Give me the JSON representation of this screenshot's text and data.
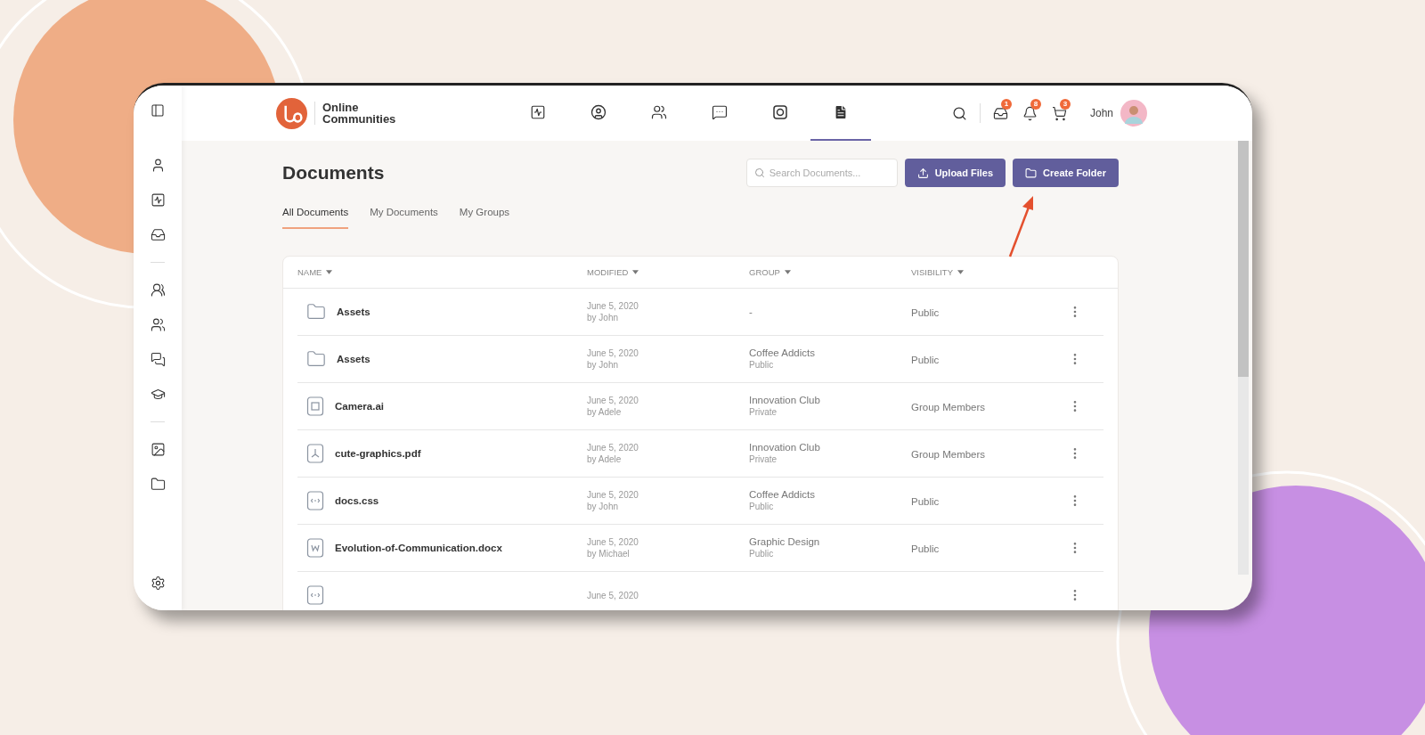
{
  "header": {
    "brand": [
      "Online",
      "Communities"
    ],
    "nav": [
      {
        "selected": false
      },
      {
        "selected": false
      },
      {
        "selected": false
      },
      {
        "selected": false
      },
      {
        "selected": false
      },
      {
        "selected": true
      }
    ],
    "badges": [
      "1",
      "8",
      "3"
    ],
    "user_name": "John"
  },
  "page": {
    "title": "Documents",
    "search": {
      "placeholder": "Search Documents..."
    },
    "buttons": [
      {
        "kind": "upload",
        "label": "Upload Files"
      },
      {
        "kind": "folder",
        "label": "Create Folder"
      }
    ],
    "tabs": [
      {
        "label": "All Documents",
        "selected": true
      },
      {
        "label": "My Documents",
        "selected": false
      },
      {
        "label": "My Groups",
        "selected": false
      }
    ]
  },
  "table": {
    "columns": [
      "NAME",
      "MODIFIED",
      "GROUP",
      "VISIBILITY"
    ],
    "rows": [
      {
        "kind": "folder",
        "name": "Assets",
        "date": "June 5, 2020",
        "by": "by John",
        "group": "-",
        "visibility": "Public"
      },
      {
        "kind": "folder",
        "name": "Assets",
        "date": "June 5, 2020",
        "by": "by John",
        "group": "Coffee Addicts",
        "group_sub": "Public",
        "visibility": "Public"
      },
      {
        "kind": "ai",
        "name": "Camera.ai",
        "date": "June 5, 2020",
        "by": "by Adele",
        "group": "Innovation Club",
        "group_sub": "Private",
        "visibility": "Group Members"
      },
      {
        "kind": "pdf",
        "name": "cute-graphics.pdf",
        "date": "June 5, 2020",
        "by": "by Adele",
        "group": "Innovation Club",
        "group_sub": "Private",
        "visibility": "Group Members"
      },
      {
        "kind": "code",
        "name": "docs.css",
        "date": "June 5, 2020",
        "by": "by John",
        "group": "Coffee Addicts",
        "group_sub": "Public",
        "visibility": "Public"
      },
      {
        "kind": "word",
        "name": "Evolution-of-Communication.docx",
        "date": "June 5, 2020",
        "by": "by Michael",
        "group": "Graphic Design",
        "group_sub": "Public",
        "visibility": "Public"
      },
      {
        "kind": "code",
        "date": "June 5, 2020"
      }
    ]
  }
}
